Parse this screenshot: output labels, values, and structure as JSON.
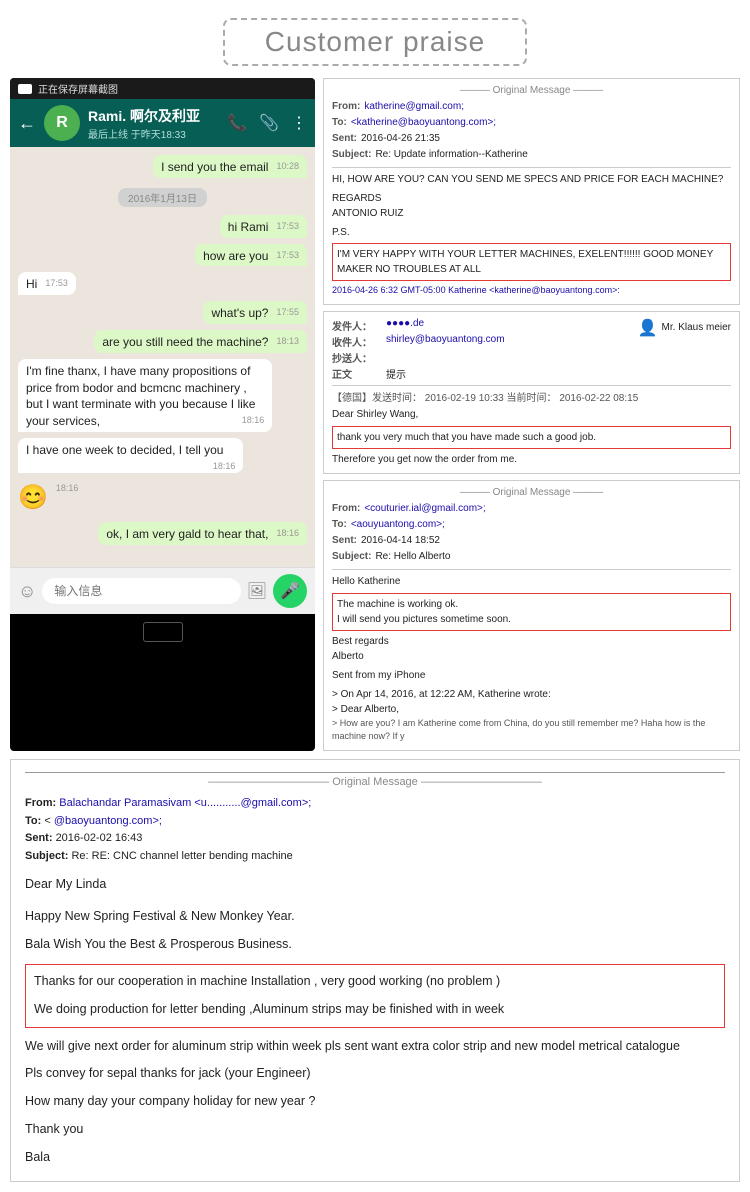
{
  "header": {
    "title": "Customer praise",
    "border_style": "dashed"
  },
  "whatsapp": {
    "status_bar_text": "正在保存屏幕截图",
    "contact_name": "Rami. 啊尔及利亚",
    "contact_status": "最后上线 于昨天18:33",
    "avatar_letter": "R",
    "messages": [
      {
        "type": "sent",
        "text": "I send you the email",
        "time": "10:28",
        "checked": true
      },
      {
        "type": "date",
        "text": "2016年1月13日"
      },
      {
        "type": "sent",
        "text": "hi Rami",
        "time": "17:53",
        "checked": true
      },
      {
        "type": "sent",
        "text": "how are you",
        "time": "17:53",
        "checked": true
      },
      {
        "type": "received",
        "text": "Hi",
        "time": "17:53"
      },
      {
        "type": "sent",
        "text": "what's up?",
        "time": "17:55",
        "checked": true
      },
      {
        "type": "sent",
        "text": "are you still need the machine?",
        "time": "18:13",
        "checked": true
      },
      {
        "type": "received",
        "text": "I'm fine thanx, I have many propositions of price from bodor and bcmcnc machinery , but I want terminate with you because I like your services,",
        "time": "18:16"
      },
      {
        "type": "received",
        "text": "I have one week to decided, I tell you",
        "time": "18:16"
      },
      {
        "type": "emoji",
        "text": "😊",
        "time": "18:16"
      },
      {
        "type": "sent",
        "text": "ok, I am very gald to hear that,",
        "time": "18:16",
        "checked": true
      }
    ],
    "input_placeholder": "输入信息",
    "back_icon": "←",
    "phone_icon": "📞",
    "attach_icon": "📎",
    "more_icon": "⋮",
    "mic_icon": "🎤"
  },
  "email1": {
    "divider": "——— Original Message ———",
    "from_label": "From:",
    "from_value": "katherine@gmail.com;",
    "to_label": "To:",
    "to_value": "<katherine@baoyuantong.com>;",
    "sent_label": "Sent:",
    "sent_value": "2016-04-26 21:35",
    "subject_label": "Subject:",
    "subject_value": "Re: Update information--Katherine",
    "body_greeting": "HI, HOW ARE YOU? CAN YOU SEND ME SPECS AND PRICE FOR EACH MACHINE?",
    "body_regards": "REGARDS",
    "body_name": "ANTONIO RUIZ",
    "ps_label": "P.S.",
    "highlight_text": "I'M VERY HAPPY WITH YOUR LETTER MACHINES, EXELENT!!!!!! GOOD MONEY MAKER NO TROUBLES AT ALL",
    "reply_line": "2016-04-26 6:32 GMT-05:00 Katherine <katherine@baoyuantong.com>:"
  },
  "email2": {
    "from_label": "发件人：",
    "from_value": "●●●●.de",
    "to_label": "收件人：",
    "to_value": "shirley@baoyuantong.com",
    "contact_name": "Mr. Klaus meier",
    "cc_label": "抄送人：",
    "subject_label": "正文",
    "subject_hint": "提示",
    "date_label": "【德国】发送时间：",
    "date_sent": "2016-02-19 10:33",
    "date_local_label": "当前时间：",
    "date_local": "2016-02-22 08:15",
    "greeting": "Dear Shirley Wang,",
    "highlight_text": "thank you very much that you have made such a good job.",
    "body2": "Therefore you get now the order from me."
  },
  "email3": {
    "divider": "Original Message",
    "from_label": "From:",
    "from_value": "<couturier.ial@gmail.com>;",
    "to_label": "To:",
    "to_value": "<aouyuantong.com>;",
    "sent_label": "Sent:",
    "sent_value": "2016-04-14 18:52",
    "subject_label": "Subject:",
    "subject_value": "Re: Hello Alberto",
    "greeting": "Hello Katherine",
    "highlight_line1": "The machine is working ok.",
    "highlight_line2": "I will send you pictures sometime soon.",
    "regards": "Best regards",
    "name": "Alberto",
    "sent_from": "Sent from my iPhone",
    "reply_header": "> On Apr 14, 2016, at 12:22 AM, Katherine wrote:",
    "reply_dear": "> Dear Alberto,",
    "reply_text": "> How are you? I am Katherine come from China, do you still remember me? Haha how is the machine now? If y"
  },
  "bottom_email": {
    "divider": "——————————— Original Message ———————————",
    "from_label": "From:",
    "from_name": "Balachandar Paramasivam",
    "from_email": "<u...........@gmail.com>;",
    "to_label": "To:",
    "to_name": "<",
    "to_email": "@baoyuantong.com>;",
    "sent_label": "Sent:",
    "sent_value": "2016-02-02 16:43",
    "subject_label": "Subject:",
    "subject_value": "Re: RE: CNC channel letter bending machine",
    "greeting": "Dear My Linda",
    "line1": "Happy New Spring Festival & New Monkey Year.",
    "line2": "Bala Wish You the Best & Prosperous Business.",
    "highlight1": "Thanks for our cooperation in machine Installation , very good working   (no problem )",
    "highlight2": "We doing production for letter bending ,Aluminum strips may be finished with in week",
    "line3": "We will give next order for aluminum strip within week pls  sent  want extra color strip and new model metrical  catalogue",
    "line4": "Pls convey for sepal thanks for jack (your Engineer)",
    "line5": "How many day your company holiday for new year ?",
    "line6": "Thank you",
    "line7": "Bala"
  }
}
